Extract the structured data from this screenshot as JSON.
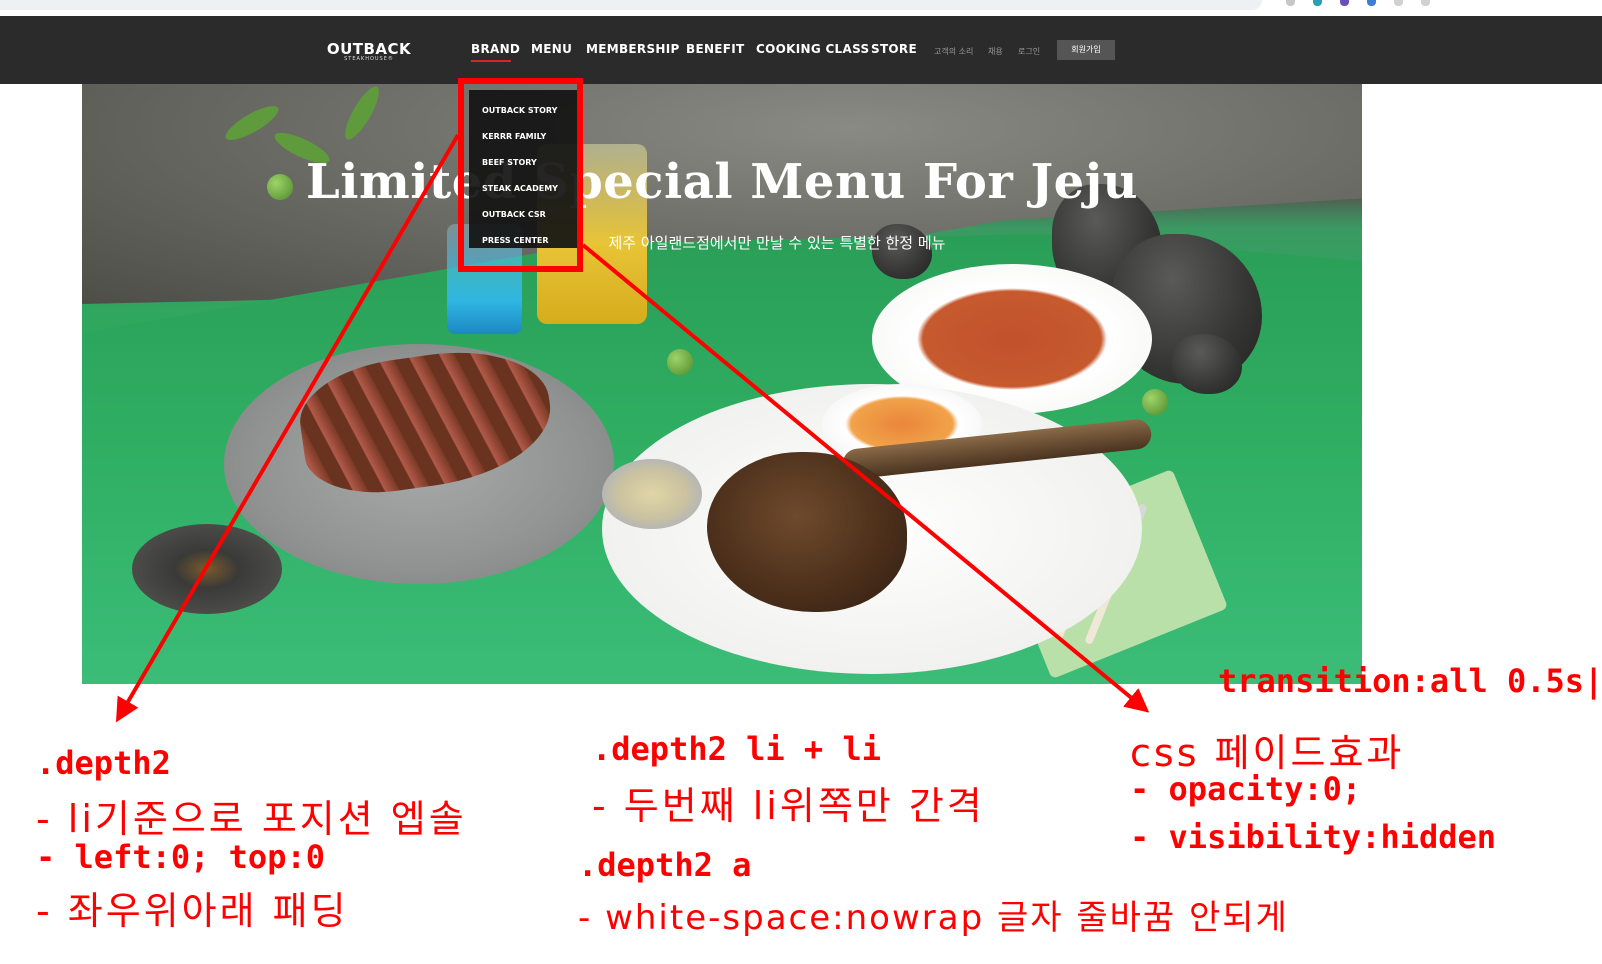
{
  "logo": {
    "main": "OUTBACK",
    "sub": "STEAKHOUSE®"
  },
  "nav": {
    "items": [
      "BRAND",
      "MENU",
      "MEMBERSHIP",
      "BENEFIT",
      "COOKING CLASS",
      "STORE"
    ],
    "active": "BRAND",
    "util_links": [
      "고객의 소리",
      "채용",
      "로그인"
    ],
    "join_label": "회원가입"
  },
  "hero": {
    "title": "Limited Special Menu For Jeju",
    "subtitle": "제주 아일랜드점에서만 만날 수 있는 특별한 한정 메뉴"
  },
  "dropdown": {
    "items": [
      "OUTBACK STORY",
      "KERRR FAMILY",
      "BEEF STORY",
      "STEAK ACADEMY",
      "OUTBACK CSR",
      "PRESS CENTER"
    ]
  },
  "annotations": {
    "depth2": {
      "heading": ".depth2",
      "lines": [
        "- li기준으로 포지션 엡솔",
        "- left:0; top:0",
        "- 좌우위아래 패딩"
      ]
    },
    "li_gap": {
      "heading": ".depth2 li + li",
      "line": "- 두번째 li위쪽만 간격"
    },
    "anchor": {
      "heading": ".depth2 a",
      "line": "- white-space:nowrap 글자 줄바꿈 안되게"
    },
    "fade": {
      "transition": "transition:all 0.5s|",
      "heading": "css 페이드효과",
      "lines": [
        "- opacity:0;",
        "- visibility:hidden"
      ]
    }
  },
  "colors": {
    "annotation_red": "#ff0000",
    "nav_bg": "#2b2b2b",
    "active_underline": "#d3262b"
  }
}
